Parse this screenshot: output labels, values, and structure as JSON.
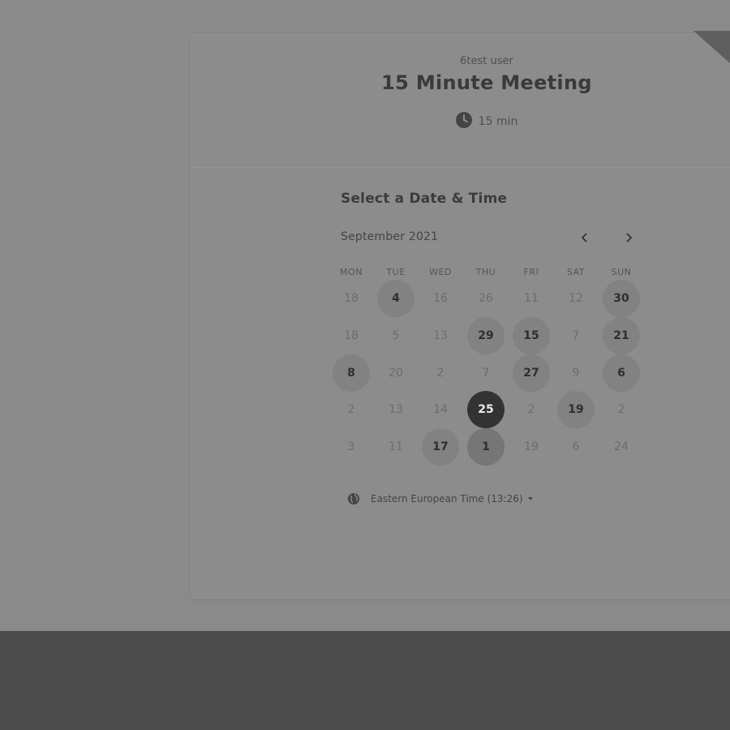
{
  "event": {
    "host": "6test user",
    "title": "15 Minute Meeting",
    "duration": "15 min"
  },
  "scheduler": {
    "heading": "Select a Date & Time",
    "month": "September 2021",
    "weekdays": [
      "MON",
      "TUE",
      "WED",
      "THU",
      "FRI",
      "SAT",
      "SUN"
    ],
    "weeks": [
      [
        {
          "label": "18",
          "state": "disabled"
        },
        {
          "label": "4",
          "state": "available"
        },
        {
          "label": "16",
          "state": "disabled"
        },
        {
          "label": "26",
          "state": "disabled"
        },
        {
          "label": "11",
          "state": "disabled"
        },
        {
          "label": "12",
          "state": "disabled"
        },
        {
          "label": "30",
          "state": "available"
        }
      ],
      [
        {
          "label": "18",
          "state": "disabled"
        },
        {
          "label": "5",
          "state": "disabled"
        },
        {
          "label": "13",
          "state": "disabled"
        },
        {
          "label": "29",
          "state": "available"
        },
        {
          "label": "15",
          "state": "available"
        },
        {
          "label": "7",
          "state": "disabled"
        },
        {
          "label": "21",
          "state": "available"
        }
      ],
      [
        {
          "label": "8",
          "state": "available"
        },
        {
          "label": "20",
          "state": "disabled"
        },
        {
          "label": "2",
          "state": "disabled"
        },
        {
          "label": "7",
          "state": "disabled"
        },
        {
          "label": "27",
          "state": "available"
        },
        {
          "label": "9",
          "state": "disabled"
        },
        {
          "label": "6",
          "state": "available"
        }
      ],
      [
        {
          "label": "2",
          "state": "disabled"
        },
        {
          "label": "13",
          "state": "disabled"
        },
        {
          "label": "14",
          "state": "disabled"
        },
        {
          "label": "25",
          "state": "selected"
        },
        {
          "label": "2",
          "state": "disabled"
        },
        {
          "label": "19",
          "state": "available"
        },
        {
          "label": "2",
          "state": "disabled"
        }
      ],
      [
        {
          "label": "3",
          "state": "disabled"
        },
        {
          "label": "11",
          "state": "disabled"
        },
        {
          "label": "17",
          "state": "available"
        },
        {
          "label": "1",
          "state": "today"
        },
        {
          "label": "19",
          "state": "disabled"
        },
        {
          "label": "6",
          "state": "disabled"
        },
        {
          "label": "24",
          "state": "disabled"
        }
      ]
    ],
    "timezone": "Eastern European Time (13:26)"
  },
  "icons": {
    "duration": "clock-icon",
    "timezone": "globe-icon",
    "prev": "chevron-left-icon",
    "next": "chevron-right-icon",
    "dropdown": "caret-down-icon"
  }
}
